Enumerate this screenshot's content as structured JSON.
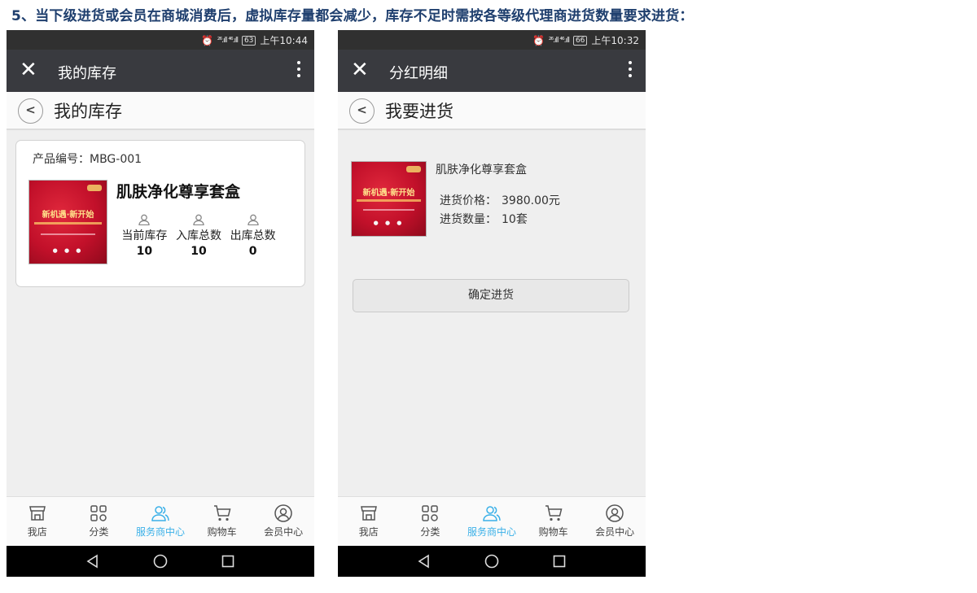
{
  "heading": "5、当下级进货或会员在商城消费后，虚拟库存量都会减少，库存不足时需按各等级代理商进货数量要求进货：",
  "colors": {
    "titlebar": "#393a3f",
    "active_tab": "#3ab0e8",
    "product_red": "#c2102a",
    "heading": "#1f3f6e"
  },
  "phone1": {
    "status": {
      "signal": "²⁶.ıll ⁴⁶.ıll",
      "battery": "63",
      "time": "上午10:44"
    },
    "title": "我的库存",
    "subheader_title": "我的库存",
    "back_icon": "chevron-left-icon",
    "card": {
      "code_line": "产品编号：MBG-001",
      "product_name": "肌肤净化尊享套盒",
      "stats": [
        {
          "label": "当前库存",
          "value": "10",
          "icon": "user-icon"
        },
        {
          "label": "入库总数",
          "value": "10",
          "icon": "user-icon"
        },
        {
          "label": "出库总数",
          "value": "0",
          "icon": "user-icon"
        }
      ]
    }
  },
  "phone2": {
    "status": {
      "signal": "²⁶.ıll ⁴⁶.ıll",
      "battery": "66",
      "time": "上午10:32"
    },
    "title": "分红明细",
    "subheader_title": "我要进货",
    "back_icon": "chevron-left-icon",
    "product_name": "肌肤净化尊享套盒",
    "price_label": "进货价格：",
    "price_value": "3980.00元",
    "qty_label": "进货数量：",
    "qty_value": "10套",
    "confirm_button": "确定进货"
  },
  "tabs": [
    {
      "label": "我店",
      "icon": "store-icon",
      "active": false
    },
    {
      "label": "分类",
      "icon": "grid-icon",
      "active": false
    },
    {
      "label": "服务商中心",
      "icon": "users-icon",
      "active": true
    },
    {
      "label": "购物车",
      "icon": "cart-icon",
      "active": false
    },
    {
      "label": "会员中心",
      "icon": "user-circle-icon",
      "active": false
    }
  ],
  "nav_buttons": [
    "back-triangle-icon",
    "home-circle-icon",
    "recents-square-icon"
  ]
}
